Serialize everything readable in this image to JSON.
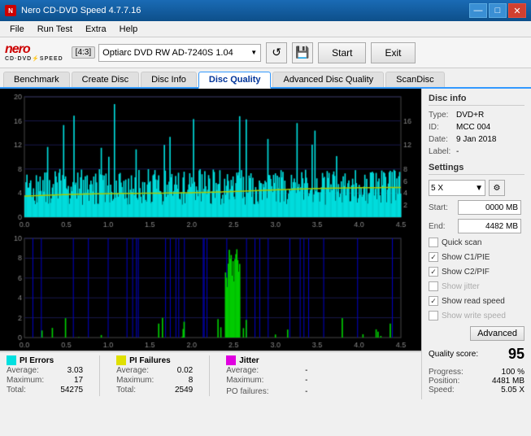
{
  "app": {
    "title": "Nero CD-DVD Speed 4.7.7.16",
    "title_icon": "N"
  },
  "title_bar": {
    "minimize": "—",
    "maximize": "□",
    "close": "✕"
  },
  "menu": {
    "items": [
      "File",
      "Run Test",
      "Extra",
      "Help"
    ]
  },
  "toolbar": {
    "aspect_ratio": "[4:3]",
    "drive": "Optiarc DVD RW AD-7240S 1.04",
    "start_label": "Start",
    "exit_label": "Exit"
  },
  "tabs": [
    {
      "label": "Benchmark",
      "active": false
    },
    {
      "label": "Create Disc",
      "active": false
    },
    {
      "label": "Disc Info",
      "active": false
    },
    {
      "label": "Disc Quality",
      "active": true
    },
    {
      "label": "Advanced Disc Quality",
      "active": false
    },
    {
      "label": "ScanDisc",
      "active": false
    }
  ],
  "disc_info": {
    "section_title": "Disc info",
    "type_label": "Type:",
    "type_value": "DVD+R",
    "id_label": "ID:",
    "id_value": "MCC 004",
    "date_label": "Date:",
    "date_value": "9 Jan 2018",
    "label_label": "Label:",
    "label_value": "-"
  },
  "settings": {
    "section_title": "Settings",
    "speed": "5 X",
    "start_label": "Start:",
    "start_value": "0000 MB",
    "end_label": "End:",
    "end_value": "4482 MB",
    "quick_scan_label": "Quick scan",
    "quick_scan_checked": false,
    "show_c1pie_label": "Show C1/PIE",
    "show_c1pie_checked": true,
    "show_c2pif_label": "Show C2/PIF",
    "show_c2pif_checked": true,
    "show_jitter_label": "Show jitter",
    "show_jitter_checked": false,
    "show_jitter_disabled": true,
    "show_read_speed_label": "Show read speed",
    "show_read_speed_checked": true,
    "show_write_speed_label": "Show write speed",
    "show_write_speed_checked": false,
    "show_write_speed_disabled": true,
    "advanced_label": "Advanced"
  },
  "quality": {
    "quality_score_label": "Quality score:",
    "quality_score_value": "95",
    "progress_label": "Progress:",
    "progress_value": "100 %",
    "position_label": "Position:",
    "position_value": "4481 MB",
    "speed_label": "Speed:",
    "speed_value": "5.05 X"
  },
  "stats": {
    "pi_errors": {
      "color": "#00e0e0",
      "label": "PI Errors",
      "average_label": "Average:",
      "average_value": "3.03",
      "maximum_label": "Maximum:",
      "maximum_value": "17",
      "total_label": "Total:",
      "total_value": "54275"
    },
    "pi_failures": {
      "color": "#e0e000",
      "label": "PI Failures",
      "average_label": "Average:",
      "average_value": "0.02",
      "maximum_label": "Maximum:",
      "maximum_value": "8",
      "total_label": "Total:",
      "total_value": "2549"
    },
    "jitter": {
      "color": "#e000e0",
      "label": "Jitter",
      "average_label": "Average:",
      "average_value": "-",
      "maximum_label": "Maximum:",
      "maximum_value": "-"
    },
    "po_failures_label": "PO failures:",
    "po_failures_value": "-"
  },
  "chart1": {
    "y_max": 20,
    "y_ticks": [
      20,
      16,
      12,
      8,
      4,
      0
    ],
    "y_right_ticks": [
      16,
      12,
      8,
      6,
      4,
      2
    ],
    "x_ticks": [
      "0.0",
      "0.5",
      "1.0",
      "1.5",
      "2.0",
      "2.5",
      "3.0",
      "3.5",
      "4.0",
      "4.5"
    ]
  },
  "chart2": {
    "y_max": 10,
    "y_ticks": [
      10,
      8,
      6,
      4,
      2,
      0
    ],
    "x_ticks": [
      "0.0",
      "0.5",
      "1.0",
      "1.5",
      "2.0",
      "2.5",
      "3.0",
      "3.5",
      "4.0",
      "4.5"
    ]
  }
}
